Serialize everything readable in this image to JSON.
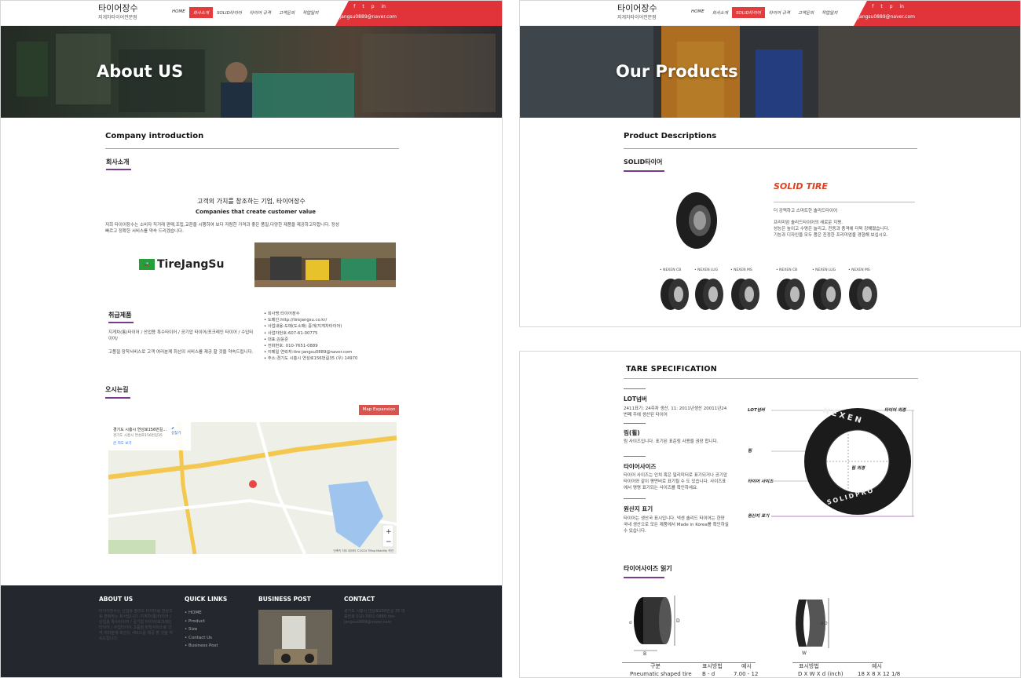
{
  "header": {
    "logo_title": "타이어장수",
    "logo_sub": "지게차타이어전문점",
    "nav": [
      "HOME",
      "회사소개",
      "SOLID타이어",
      "타이어 규격",
      "고객문의",
      "작업일지"
    ],
    "email": "tire-jangsu0889@naver.com",
    "social_icons": [
      "facebook-icon",
      "twitter-icon",
      "pinterest-icon",
      "linkedin-icon"
    ]
  },
  "about": {
    "hero_title": "About US",
    "section_title": "Company introduction",
    "sub_title": "회사소개",
    "headline_kr": "고객의 가치를 창조하는 기업, 타이어장수",
    "headline_en": "Companies that create customer value",
    "intro": "저희 타이어장수는 소비자 직거래 판매,조립,교환을 시행하여 보다 저렴한 가격과 좋은 품질,다양한 제품을 제공하고자합니다. 정성 빠르고 정확한 서비스를 약속 드리겠습니다.",
    "brand": "TireJangSu",
    "products_title": "취급제품",
    "products_text": "지게차(통)타이어 / 산업용 특수타이어 / 공기압 타이어/포크레인 타이어 / 수입타이어/",
    "products_text2": "고품질 장착서비스로 고객 여러분께 최선의 서비스를 제공 할 것을 약속드립니다.",
    "company_info": [
      "회사명:타이어장수",
      "도메인:http://tirejangsu.co.kr/",
      "사업내용:도매(도소매) 중개(지게차타이어)",
      "사업자번호:607-61-00775",
      "대표:김윤준",
      "전화번호: 010-7651-0889",
      "이메일 연락처:tire-jangsu0889@naver.com",
      "주소:경기도 시흥시 연성로156번길35 (우) 14970"
    ],
    "map_title": "오시는길",
    "map_button": "Map Expansion",
    "map_address": "경기도 시흥시 연성로156번길...",
    "map_address_sub": "경기도 시흥시 연성로156번길35",
    "map_link": "큰 지도 보기",
    "map_route": "길찾기",
    "map_credit": "단축키  지도 데이터 ©2024 TMap Mobility  약관"
  },
  "footer": {
    "cols": [
      "ABOUT US",
      "QUICK LINKS",
      "BUSINESS POST",
      "CONTACT"
    ],
    "quick_links": [
      "HOME",
      "Product",
      "Size",
      "Contact Us",
      "Business Post"
    ],
    "about_text": "타이어장수는 산업용 솔리드 타이어를 전문으로 판매하는 회사입니다. 지게차(통)타이어 / 산업용 특수타이어 / 공기압 타이어/포크레인 타이어 / 수입타이어 고품질 장착서비스로 고객 여러분께 최선의 서비스를 제공 할 것을 약속드립니다.",
    "contact_text": "경기도 시흥시 연성로156번길 35 대표번호 010-7651-0889 tire-jangsu0889@naver.com"
  },
  "products": {
    "hero_title": "Our Products",
    "section_title": "Product Descriptions",
    "sub_title": "SOLID타이어",
    "solid_heading": "SOLID TIRE",
    "desc1": "더 강력하고 스마트한 솔리드타이어",
    "desc2": "프리미엄 솔리드타이어의 새로운 지평.",
    "desc3": "성능은 높이고 수명은 늘리고, 진동과 충격에 더욱 강해졌습니다.",
    "desc4": "기능과 디자인을 모두 품은 진정한 프리미엄을 경험해 보십시오.",
    "variants": [
      "• NEXEN CB",
      "• NEXEN LUG",
      "• NEXEN MS",
      "• NEXEN CB",
      "• NEXEN LUG",
      "• NEXEN MS"
    ]
  },
  "spec": {
    "title": "TARE SPECIFICATION",
    "items": [
      {
        "t": "LOT넘버",
        "d": "2411표기: 24주차 생산, 11: 2011년생산 20011년24번째 주에 생산된 타이어"
      },
      {
        "t": "림(휠)",
        "d": "림 사이즈입니다. 표기된 표준림 사용을 권장 합니다."
      },
      {
        "t": "타이어사이즈",
        "d": "타이어 사이즈는 인치 혹은 밀리미터로 표기되거나 공기압 타이어와 같이 평면비로 표기될 수 도 있습니다. 사이즈표에서 명명 표기되는 사이즈를 확인하세요."
      },
      {
        "t": "원산지 표기",
        "d": "타이어는 생산국 표시입니다. 넥센 솔리드 타이어는 한양 국내 생산으로 모든 제품에서 Made in Korea를 확인하실 수 있습니다."
      }
    ],
    "labels": [
      "LOT넘버",
      "타이어 외경",
      "림",
      "림 외경",
      "타이어 사이즈",
      "원산지 표기"
    ],
    "tire_brand": "NEXEN",
    "tire_model": "SOLIDPRO",
    "size_title": "타이어사이즈 읽기",
    "table": {
      "left_head": [
        "구분",
        "표시방법",
        "예시"
      ],
      "left_row": [
        "Pneumatic shaped tire",
        "B - d",
        "7.00 - 12"
      ],
      "right_head": [
        "표시방법",
        "예시"
      ],
      "right_row": [
        "D X W X d (inch)",
        "18 X 8 X 12 1/8"
      ]
    }
  },
  "colors": {
    "accent": "#e0343a",
    "purple": "#7b3b8c",
    "footer": "#24272d"
  }
}
